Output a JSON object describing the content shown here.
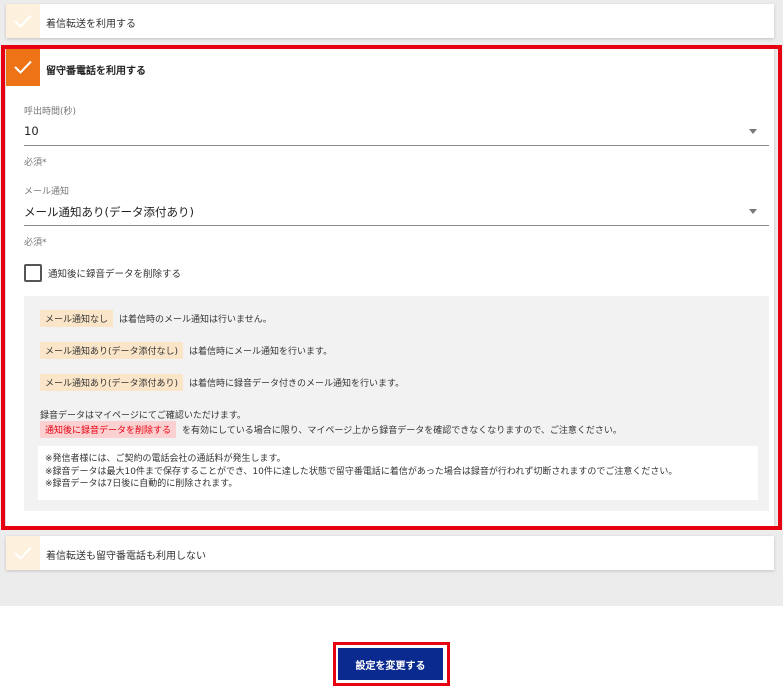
{
  "options": {
    "forwarding": {
      "label": "着信転送を利用する",
      "checked": false
    },
    "voicemail": {
      "label": "留守番電話を利用する",
      "checked": true
    },
    "none": {
      "label": "着信転送も留守番電話も利用しない",
      "checked": false
    }
  },
  "ring_time": {
    "label": "呼出時間(秒)",
    "value": "10",
    "helper": "必須*"
  },
  "mail_notify": {
    "label": "メール通知",
    "value": "メール通知あり(データ添付あり)",
    "helper": "必須*"
  },
  "delete_after_notify": {
    "label": "通知後に録音データを削除する",
    "checked": false
  },
  "info": {
    "line1_tag": "メール通知なし",
    "line1_text": "は着信時のメール通知は行いません。",
    "line2_tag": "メール通知あり(データ添付なし)",
    "line2_text": "は着信時にメール通知を行います。",
    "line3_tag": "メール通知あり(データ添付あり)",
    "line3_text": "は着信時に録音データ付きのメール通知を行います。",
    "line4_text": "録音データはマイページにてご確認いただけます。",
    "line5_tag": "通知後に録音データを削除する",
    "line5_text": "を有効にしている場合に限り、マイページ上から録音データを確認できなくなりますので、ご注意ください。",
    "notes": [
      "※発信者様には、ご契約の電話会社の通話料が発生します。",
      "※録音データは最大10件まで保存することができ、10件に達した状態で留守番電話に着信があった場合は録音が行われず切断されますのでご注意ください。",
      "※録音データは7日後に自動的に削除されます。"
    ]
  },
  "submit_label": "設定を変更する",
  "colors": {
    "accent_orange": "#ee7316",
    "highlight_red": "#e60012",
    "button_navy": "#0b2a8f"
  }
}
